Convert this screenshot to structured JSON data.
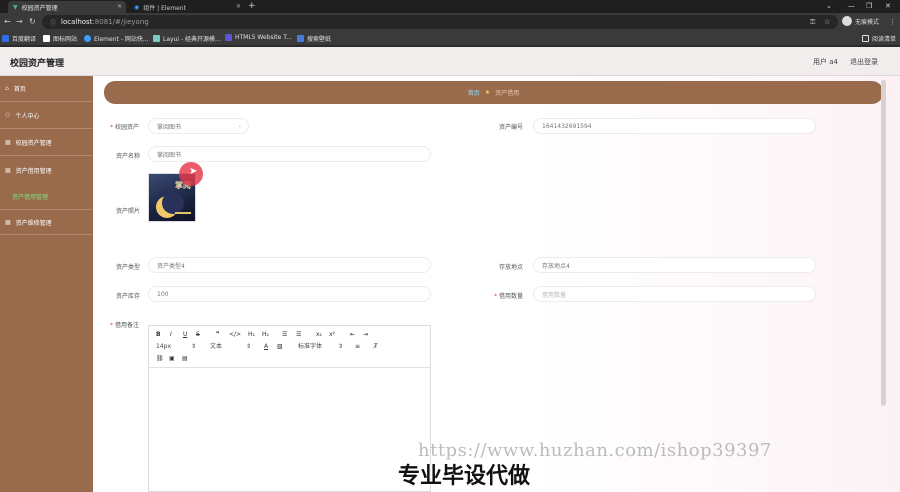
{
  "browser": {
    "tabs": [
      {
        "title": "校园资产管理",
        "active": true
      },
      {
        "title": "组件 | Element",
        "active": false
      }
    ],
    "url_host": "localhost",
    "url_rest": ":8081/#/jieyong",
    "incognito_label": "无痕模式",
    "bookmarks": [
      "百度翻译",
      "图标网站",
      "Element - 网站快...",
      "Layui - 经典开源模...",
      "HTML5 Website T...",
      "搜索壁纸"
    ],
    "reading_list": "阅读清单"
  },
  "header": {
    "title": "校园资产管理",
    "user_label": "用户 a4",
    "logout_label": "退出登录"
  },
  "sidebar": {
    "items": [
      {
        "label": "首页"
      },
      {
        "label": "个人中心"
      },
      {
        "label": "校园资产管理"
      },
      {
        "label": "资产借用管理"
      },
      {
        "label": "资产维修管理"
      }
    ],
    "submenu": [
      {
        "label": "资产借用管理",
        "active": true
      }
    ]
  },
  "breadcrumb": {
    "home": "首页",
    "current": "资产借用"
  },
  "form": {
    "campus_asset": {
      "label": "校园资产",
      "value": "掌阅图书"
    },
    "asset_number": {
      "label": "资产编号",
      "value": "1641432691594"
    },
    "asset_name": {
      "label": "资产名称",
      "value": "掌阅图书"
    },
    "asset_photo": {
      "label": "资产照片",
      "image_text": "掌阅"
    },
    "asset_type": {
      "label": "资产类型",
      "value": "资产类型4"
    },
    "storage_location": {
      "label": "存放地点",
      "value": "存放地点4"
    },
    "asset_stock": {
      "label": "资产库存",
      "value": "100"
    },
    "borrow_quantity": {
      "label": "借用数量",
      "placeholder": "借用数量"
    },
    "borrow_note": {
      "label": "借用备注"
    }
  },
  "editor": {
    "font_size": "14px",
    "text_style": "文本",
    "font_family": "标准字体"
  },
  "watermark": {
    "url": "https://www.huzhan.com/ishop39397",
    "slogan": "专业毕设代做"
  }
}
